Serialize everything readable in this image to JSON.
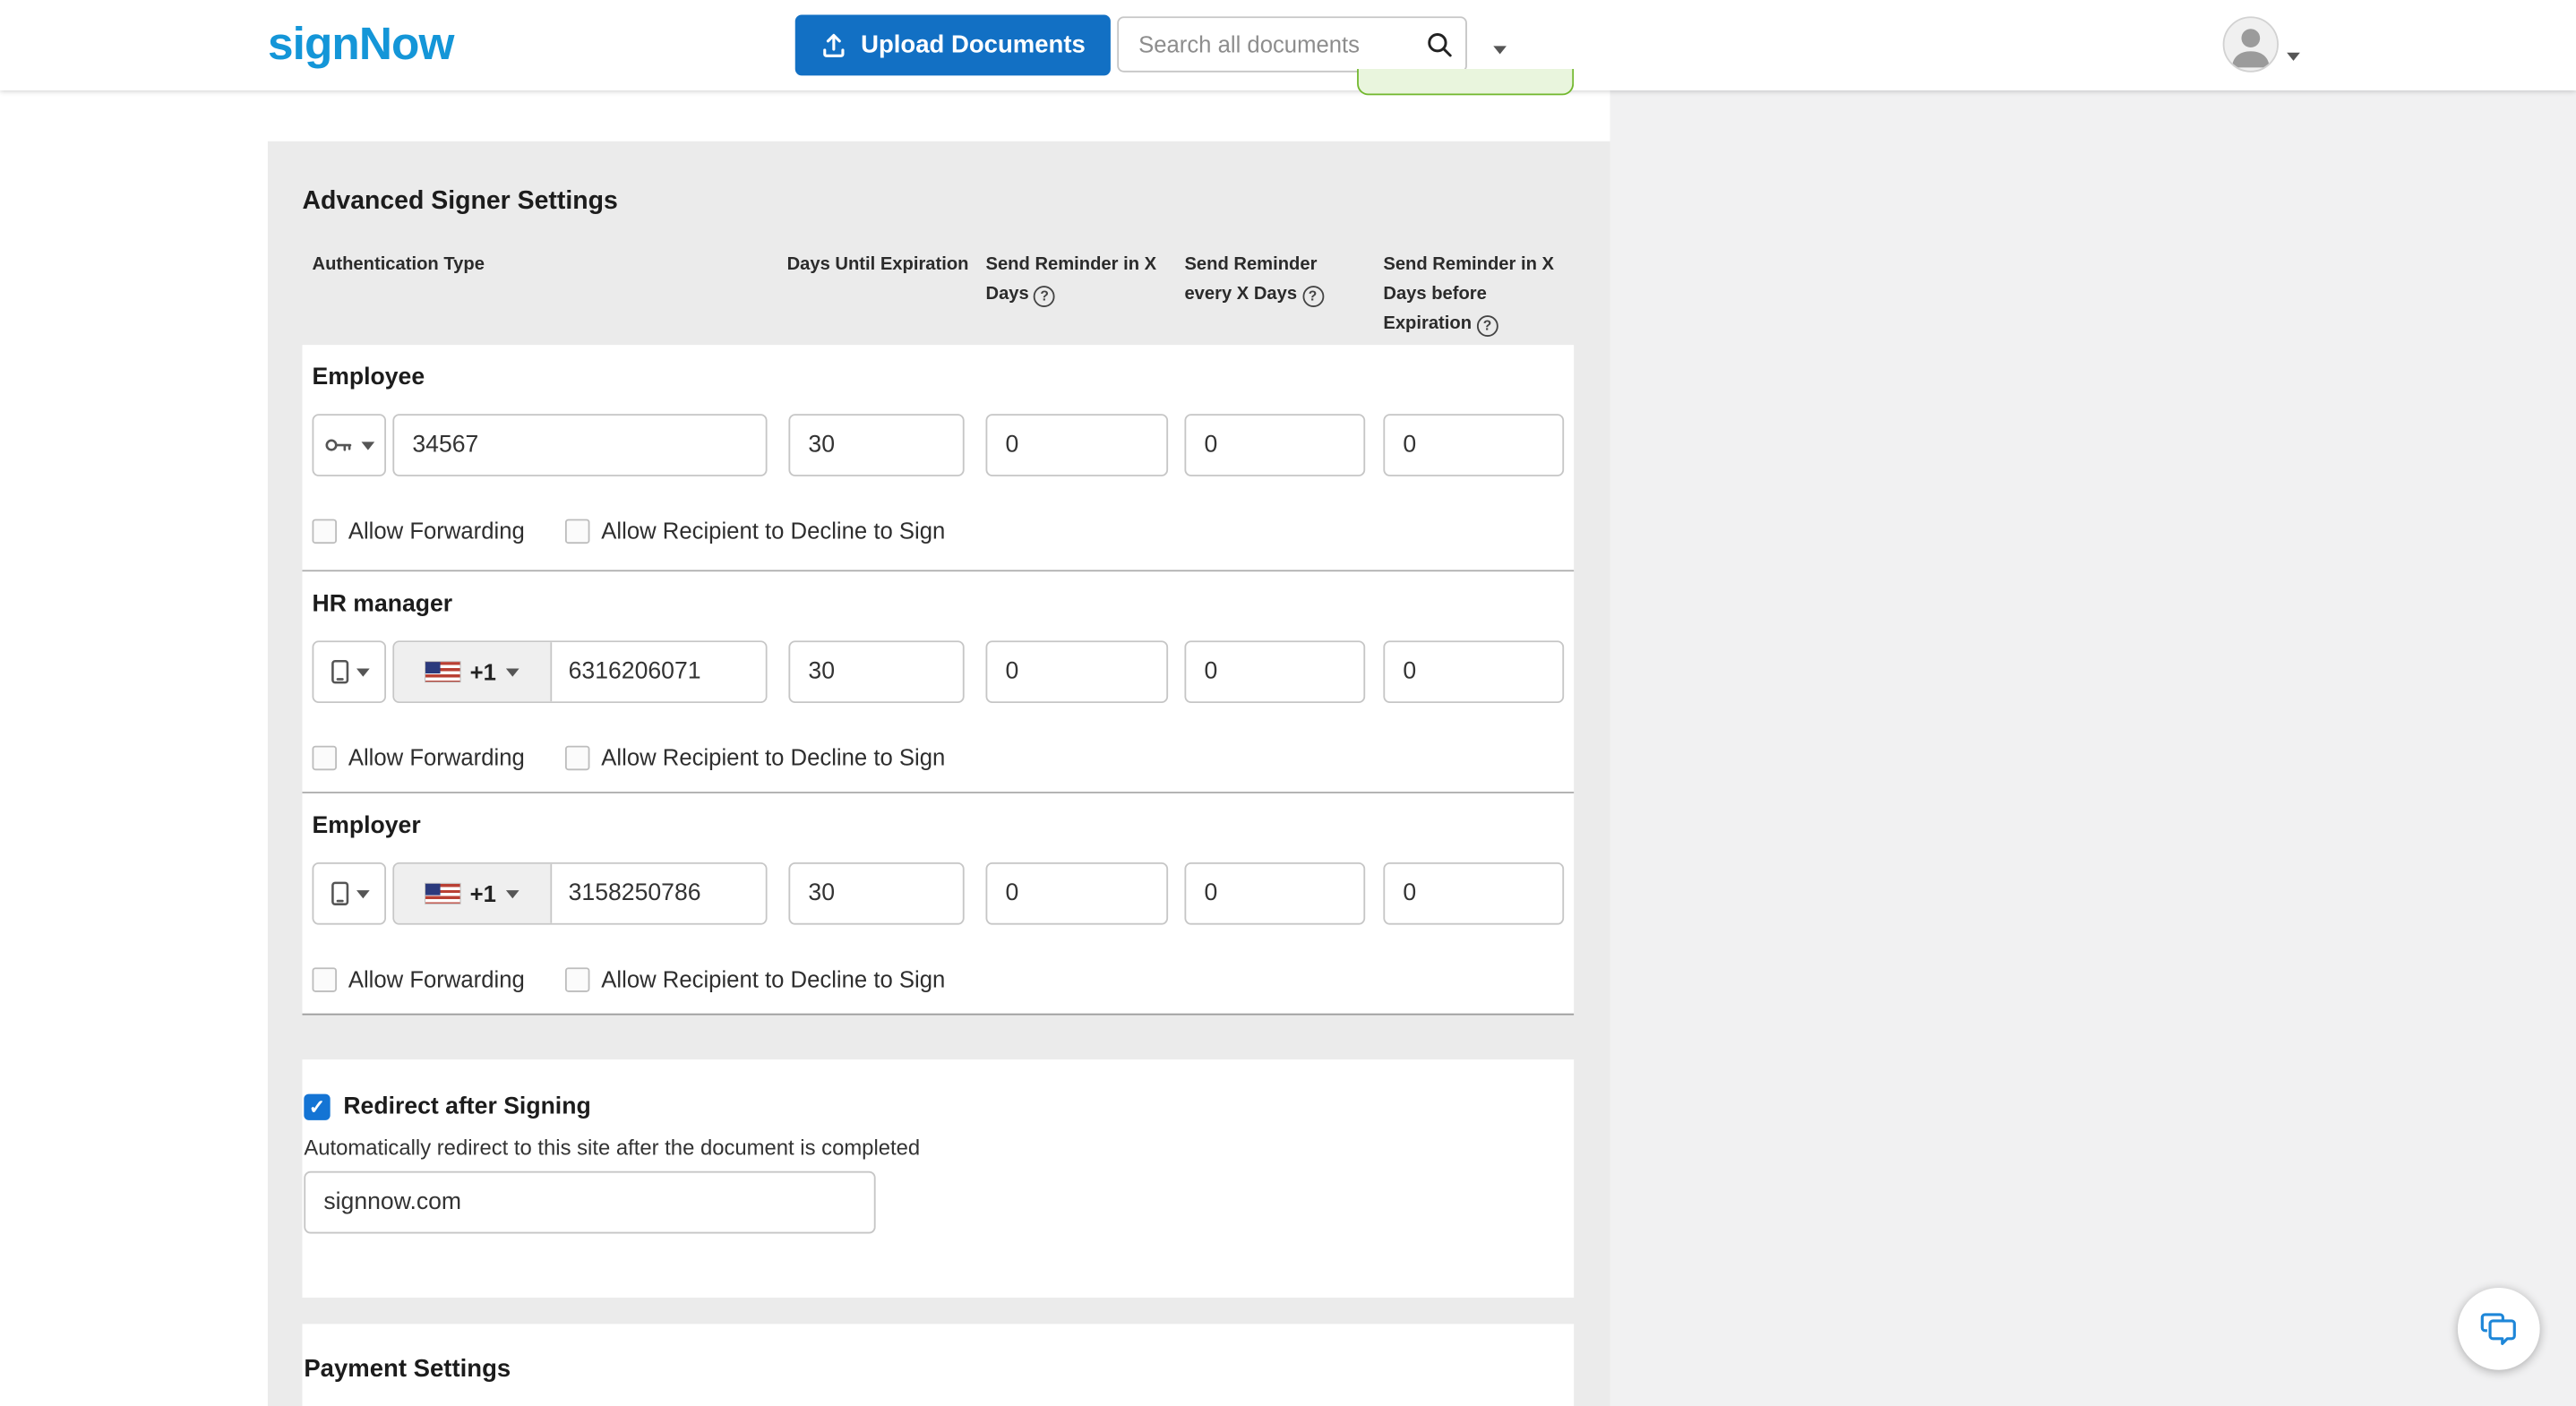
{
  "header": {
    "logo": "signNow",
    "upload_button": "Upload Documents",
    "search": {
      "placeholder": "Search all documents"
    }
  },
  "settings": {
    "title": "Advanced Signer Settings",
    "columns": {
      "auth": "Authentication Type",
      "expiration": "Days Until Expiration",
      "reminder_in": "Send Reminder in X Days",
      "reminder_every": "Send Reminder every X Days",
      "reminder_before": "Send Reminder in X Days before Expiration"
    },
    "checkbox_labels": {
      "forwarding": "Allow Forwarding",
      "decline": "Allow Recipient to Decline to Sign"
    },
    "signers": [
      {
        "name": "Employee",
        "auth_icon": "key-icon",
        "value": "34567",
        "expiration": "30",
        "reminder_in": "0",
        "reminder_every": "0",
        "reminder_before": "0"
      },
      {
        "name": "HR manager",
        "auth_icon": "phone-icon",
        "country_code": "+1",
        "value": "6316206071",
        "expiration": "30",
        "reminder_in": "0",
        "reminder_every": "0",
        "reminder_before": "0"
      },
      {
        "name": "Employer",
        "auth_icon": "phone-icon",
        "country_code": "+1",
        "value": "3158250786",
        "expiration": "30",
        "reminder_in": "0",
        "reminder_every": "0",
        "reminder_before": "0"
      }
    ],
    "redirect": {
      "label": "Redirect after Signing",
      "description": "Automatically redirect to this site after the document is completed",
      "value": "signnow.com"
    },
    "payment": {
      "title": "Payment Settings"
    },
    "help_icon_glyph": "?"
  },
  "icons": {
    "upload": "upload-tray-arrow",
    "search": "magnifier",
    "user": "person-silhouette",
    "auth_password": "key",
    "auth_sms": "smartphone",
    "country_flag": "us-flag",
    "chat": "speech-bubbles"
  },
  "colors": {
    "brand_blue": "#1496d8",
    "button_blue": "#1270c4",
    "checked_blue": "#1474d4",
    "green_button_border": "#72b82e",
    "panel_gray": "#ebebeb"
  }
}
